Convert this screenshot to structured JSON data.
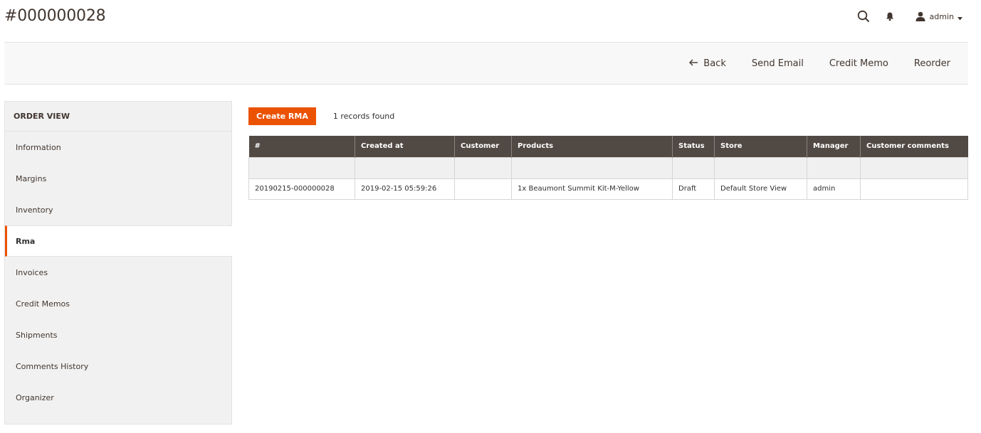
{
  "page_title": "#000000028",
  "topbar": {
    "user_name": "admin"
  },
  "action_bar": {
    "back_label": "Back",
    "send_email_label": "Send Email",
    "credit_memo_label": "Credit Memo",
    "reorder_label": "Reorder"
  },
  "sidebar": {
    "title": "ORDER VIEW",
    "items": [
      {
        "label": "Information"
      },
      {
        "label": "Margins"
      },
      {
        "label": "Inventory"
      },
      {
        "label": "Rma",
        "active": true
      },
      {
        "label": "Invoices"
      },
      {
        "label": "Credit Memos"
      },
      {
        "label": "Shipments"
      },
      {
        "label": "Comments History"
      },
      {
        "label": "Organizer"
      }
    ]
  },
  "rma": {
    "create_label": "Create RMA",
    "records_count": "1",
    "records_text": "records found",
    "columns": [
      "#",
      "Created at",
      "Customer",
      "Products",
      "Status",
      "Store",
      "Manager",
      "Customer comments"
    ],
    "rows": [
      [
        "20190215-000000028",
        "2019-02-15 05:59:26",
        "",
        "1x Beaumont Summit Kit-M-Yellow",
        "Draft",
        "Default Store View",
        "admin",
        ""
      ]
    ]
  },
  "colors": {
    "accent": "#eb5202",
    "header_bg": "#514943"
  }
}
